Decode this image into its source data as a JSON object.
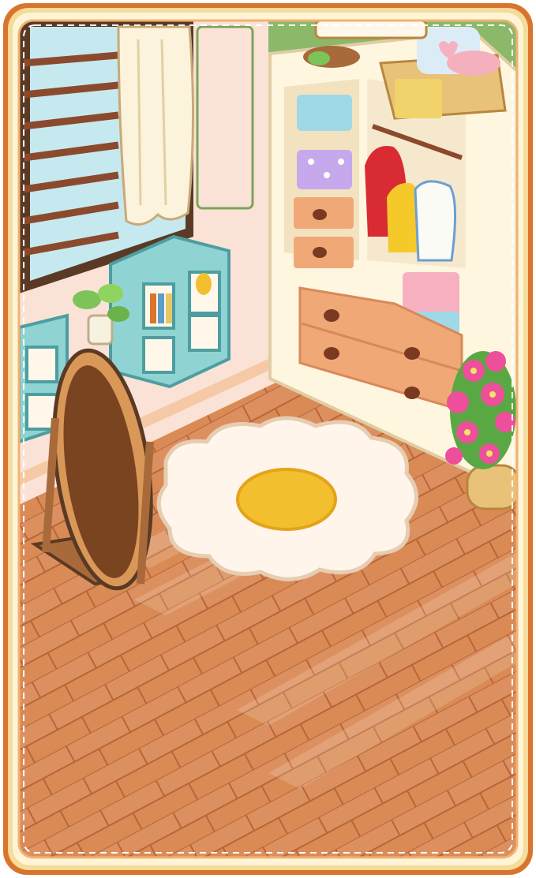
{
  "scene": {
    "name": "dressing-room",
    "palette": {
      "frame_outer": "#d9742d",
      "frame_inner": "#f6dc9a",
      "frame_cream": "#fff4d6",
      "wall_green": "#8cb86a",
      "wall_pink": "#fbe2d6",
      "floor_wood": "#d98a55",
      "floor_dark": "#c97443",
      "shelf_cream": "#fff6df",
      "drawer_peach": "#f0a877",
      "cube_teal": "#8fd3d2",
      "rug_white": "#fff5ea",
      "rug_yolk": "#f2c02e",
      "flower_pink": "#ee4f9a",
      "mirror_frame": "#a86a3a"
    },
    "icons": {
      "window": "window-blinds-icon",
      "curtain": "curtain-icon",
      "plant": "potted-plant-icon",
      "mirror": "standing-mirror-icon",
      "rug": "flower-rug-icon",
      "wardrobe": "wardrobe-icon",
      "flowers": "flower-pot-icon",
      "basket": "basket-icon"
    }
  }
}
